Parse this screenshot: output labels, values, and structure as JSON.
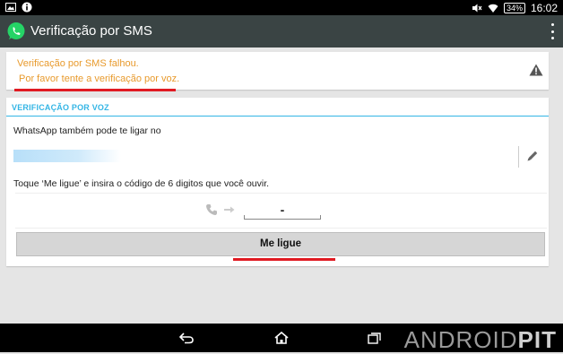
{
  "status_bar": {
    "time": "16:02",
    "battery": "34%",
    "left_icons": [
      "image-icon",
      "info-icon"
    ],
    "right_icons": [
      "mute-icon",
      "wifi-icon",
      "battery-icon"
    ]
  },
  "action_bar": {
    "title": "Verificação por SMS",
    "logo_icon": "whatsapp-icon",
    "overflow_icon": "overflow-menu-icon"
  },
  "warning": {
    "line1": "Verificação por SMS falhou.",
    "line2": "Por favor tente a verificação por voz.",
    "icon": "warning-icon",
    "color": "#e89a2c"
  },
  "voice_verification": {
    "section_title": "VERIFICAÇÃO POR VOZ",
    "intro": "WhatsApp também pode te ligar no",
    "instructions": "Toque ‘Me ligue’ e insira o código de 6 digitos que você ouvir.",
    "code_value": "-",
    "call_button_label": "Me ligue",
    "accent_color": "#33b5e5"
  },
  "nav_bar": {
    "buttons": [
      "back-icon",
      "home-icon",
      "recent-apps-icon"
    ],
    "watermark_a": "ANDROID",
    "watermark_b": "PIT"
  },
  "highlight_color": "#e01a22"
}
